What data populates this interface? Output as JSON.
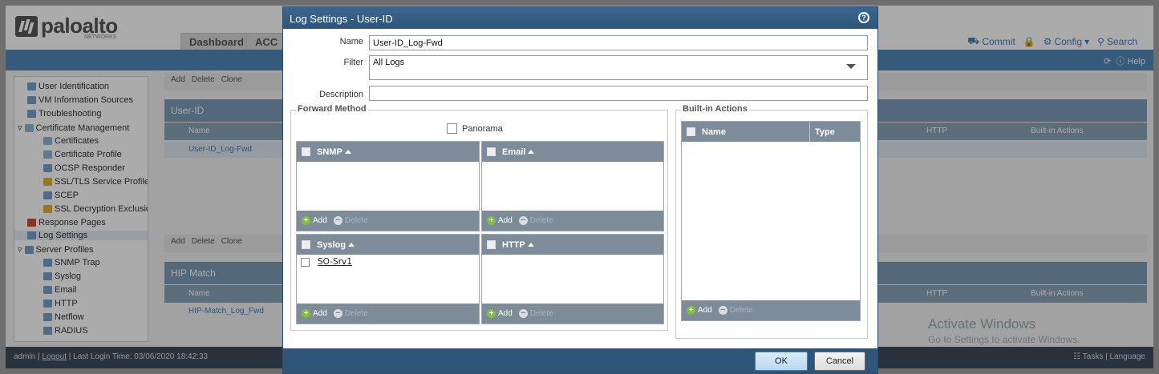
{
  "app": {
    "logo_text": "paloalto",
    "logo_sub": "NETWORKS",
    "tabs": [
      "Dashboard",
      "ACC"
    ],
    "top_actions": {
      "commit": "Commit",
      "config": "Config",
      "search": "Search"
    },
    "help": "Help",
    "sidebar": [
      "User Identification",
      "VM Information Sources",
      "Troubleshooting",
      "Certificate Management",
      "Certificates",
      "Certificate Profile",
      "OCSP Responder",
      "SSL/TLS Service Profile",
      "SCEP",
      "SSL Decryption Exclusion",
      "Response Pages",
      "Log Settings",
      "Server Profiles",
      "SNMP Trap",
      "Syslog",
      "Email",
      "HTTP",
      "Netflow",
      "RADIUS"
    ],
    "toolbar": {
      "add": "Add",
      "delete": "Delete",
      "clone": "Clone"
    },
    "sections": [
      {
        "title": "User-ID",
        "col_name": "Name",
        "col_http": "HTTP",
        "col_actions": "Built-in Actions",
        "row": "User-ID_Log-Fwd"
      },
      {
        "title": "HIP Match",
        "col_name": "Name",
        "col_http": "HTTP",
        "col_actions": "Built-in Actions",
        "row": "HIP-Match_Log_Fwd"
      }
    ],
    "status": {
      "user": "admin",
      "logout": "Logout",
      "last_login": "Last Login Time: 03/06/2020 18:42:33",
      "tasks": "Tasks",
      "language": "Language"
    },
    "watermark": {
      "line1": "Activate Windows",
      "line2": "Go to Settings to activate Windows."
    }
  },
  "dialog": {
    "title": "Log Settings - User-ID",
    "name_label": "Name",
    "name_value": "User-ID_Log-Fwd",
    "filter_label": "Filter",
    "filter_value": "All Logs",
    "description_label": "Description",
    "description_value": "",
    "forward_method_legend": "Forward Method",
    "panorama_label": "Panorama",
    "grids": {
      "snmp": {
        "header": "SNMP",
        "rows": []
      },
      "email": {
        "header": "Email",
        "rows": []
      },
      "syslog": {
        "header": "Syslog",
        "rows": [
          "SO-Srv1"
        ]
      },
      "http": {
        "header": "HTTP",
        "rows": []
      }
    },
    "builtin_legend": "Built-in Actions",
    "builtin_cols": {
      "name": "Name",
      "type": "Type"
    },
    "add_label": "Add",
    "delete_label": "Delete",
    "ok_label": "OK",
    "cancel_label": "Cancel"
  }
}
